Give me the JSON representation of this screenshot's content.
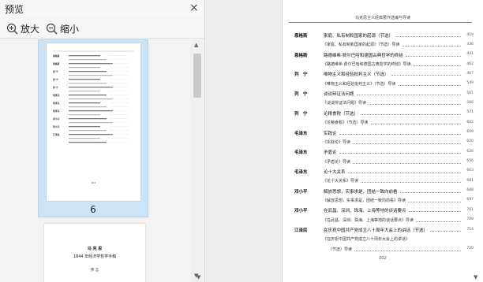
{
  "panel": {
    "title": "预览",
    "close_glyph": "×",
    "zoom_in_label": "放大",
    "zoom_out_label": "缩小"
  },
  "thumbnails": [
    {
      "page_number": "6",
      "selected": true
    },
    {
      "page_number": "",
      "selected": false,
      "lines": [
        "马 克 思",
        "1844 年经济学哲学手稿",
        "序 言"
      ]
    }
  ],
  "document": {
    "header": "马克思主义经典著作选编与导读",
    "footer": "002",
    "toc": [
      {
        "author": "恩格斯",
        "title": "家庭、私有制和国家的起源（节选）",
        "page": "419"
      },
      {
        "author": "",
        "title": "《家庭、私有制和国家的起源》（节选）导读",
        "page": "436",
        "sub": true
      },
      {
        "author": "恩格斯",
        "title": "路德维希·费尔巴哈和德国古典哲学的终结",
        "page": "441"
      },
      {
        "author": "",
        "title": "《路德维希·费尔巴哈和德国古典哲学的终结》导读",
        "page": "462",
        "sub": true
      },
      {
        "author": "列　宁",
        "title": "唯物主义和经验批判主义（节选）",
        "page": "467"
      },
      {
        "author": "",
        "title": "《唯物主义和经验批判主义》（节选）导读",
        "page": "549",
        "sub": true
      },
      {
        "author": "列　宁",
        "title": "谈谈辩证法问题",
        "page": "561"
      },
      {
        "author": "",
        "title": "《谈谈辩证法问题》导读",
        "page": "566",
        "sub": true
      },
      {
        "author": "列　宁",
        "title": "论粮食税（节选）",
        "page": "571"
      },
      {
        "author": "",
        "title": "《论粮食税》（节选）导读",
        "page": "602",
        "sub": true
      },
      {
        "author": "毛泽东",
        "title": "实践论",
        "page": "609"
      },
      {
        "author": "",
        "title": "《实践论》导读",
        "page": "620",
        "sub": true
      },
      {
        "author": "毛泽东",
        "title": "矛盾论",
        "page": "626"
      },
      {
        "author": "",
        "title": "《矛盾论》导读",
        "page": "656",
        "sub": true
      },
      {
        "author": "毛泽东",
        "title": "论十大关系",
        "page": "663"
      },
      {
        "author": "",
        "title": "《论十大关系》导读",
        "page": "681",
        "sub": true
      },
      {
        "author": "邓小平",
        "title": "解放思想，实事求是，团结一致向前看",
        "page": "688"
      },
      {
        "author": "",
        "title": "《解放思想，实事求是，团结一致向前看》导读",
        "page": "697",
        "sub": true
      },
      {
        "author": "邓小平",
        "title": "在武昌、深圳、珠海、上海等地的谈话要点",
        "page": "701"
      },
      {
        "author": "",
        "title": "《在武昌、深圳、珠海、上海等地的谈话要点》导读",
        "page": "709",
        "sub": true
      },
      {
        "author": "江泽民",
        "title": "在庆祝中国共产党成立八十周年大会上的讲话（节选）",
        "page": "714"
      },
      {
        "author": "",
        "title": "《在庆祝中国共产党成立八十周年大会上的讲话》",
        "page": "",
        "sub": true
      },
      {
        "author": "",
        "title": "（节选）导读",
        "page": "720",
        "sub": true,
        "indent": true
      }
    ]
  },
  "thumb_toc": [
    "恩格斯",
    "恩格斯",
    "列 宁",
    "列 宁",
    "列 宁",
    "毛泽东",
    "毛泽东",
    "毛泽东",
    "邓小平",
    "邓小平",
    "江泽民"
  ],
  "colors": {
    "selection": "#cde4f7",
    "panel_bg": "#f3f3f3"
  }
}
